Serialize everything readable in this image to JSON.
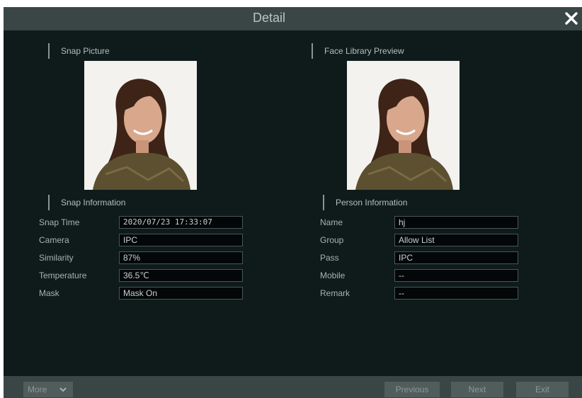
{
  "dialog": {
    "title": "Detail",
    "close_icon": "close-icon"
  },
  "snap": {
    "picture_label": "Snap Picture",
    "info_label": "Snap Information",
    "fields": [
      {
        "label": "Snap Time",
        "value": "2020/07/23 17:33:07"
      },
      {
        "label": "Camera",
        "value": "IPC"
      },
      {
        "label": "Similarity",
        "value": "87%"
      },
      {
        "label": "Temperature",
        "value": "36.5℃"
      },
      {
        "label": "Mask",
        "value": "Mask On"
      }
    ]
  },
  "library": {
    "preview_label": "Face Library Preview",
    "info_label": "Person Information",
    "fields": [
      {
        "label": "Name",
        "value": "hj"
      },
      {
        "label": "Group",
        "value": "Allow List"
      },
      {
        "label": "Pass",
        "value": "IPC"
      },
      {
        "label": "Mobile",
        "value": "--"
      },
      {
        "label": "Remark",
        "value": "--"
      }
    ]
  },
  "footer": {
    "more_label": "More",
    "previous_label": "Previous",
    "next_label": "Next",
    "exit_label": "Exit"
  },
  "colors": {
    "background": "#0f1b1b",
    "bar": "#3a4646",
    "pointer_accent": "#e8151b"
  }
}
